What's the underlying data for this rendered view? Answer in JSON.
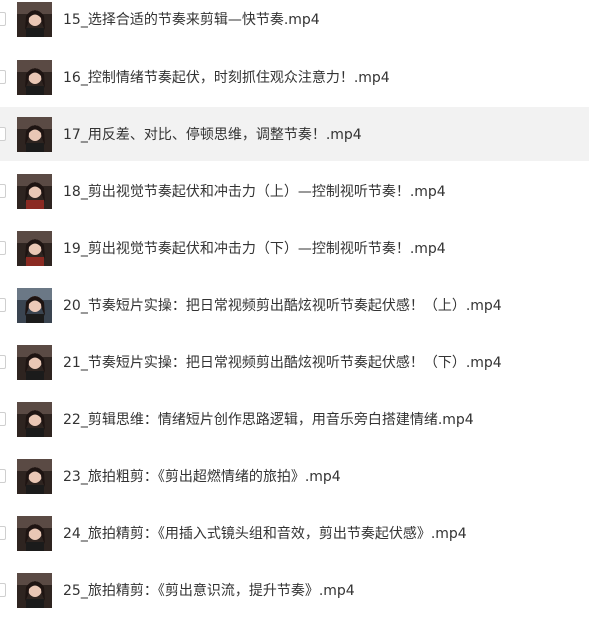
{
  "files": [
    {
      "name": "15_选择合适的节奏来剪辑—快节奏.mp4",
      "thumbnail": "video-thumbnail-icon",
      "hovered": false
    },
    {
      "name": "16_控制情绪节奏起伏，时刻抓住观众注意力！.mp4",
      "thumbnail": "video-thumbnail-icon",
      "hovered": false
    },
    {
      "name": "17_用反差、对比、停顿思维，调整节奏！.mp4",
      "thumbnail": "video-thumbnail-icon",
      "hovered": true
    },
    {
      "name": "18_剪出视觉节奏起伏和冲击力（上）—控制视听节奏！.mp4",
      "thumbnail": "video-thumbnail-icon",
      "hovered": false
    },
    {
      "name": "19_剪出视觉节奏起伏和冲击力（下）—控制视听节奏！.mp4",
      "thumbnail": "video-thumbnail-icon",
      "hovered": false
    },
    {
      "name": "20_节奏短片实操：把日常视频剪出酷炫视听节奏起伏感！（上）.mp4",
      "thumbnail": "video-thumbnail-icon",
      "hovered": false
    },
    {
      "name": "21_节奏短片实操：把日常视频剪出酷炫视听节奏起伏感！（下）.mp4",
      "thumbnail": "video-thumbnail-icon",
      "hovered": false
    },
    {
      "name": "22_剪辑思维：情绪短片创作思路逻辑，用音乐旁白搭建情绪.mp4",
      "thumbnail": "video-thumbnail-icon",
      "hovered": false
    },
    {
      "name": "23_旅拍粗剪：《剪出超燃情绪的旅拍》.mp4",
      "thumbnail": "video-thumbnail-icon",
      "hovered": false
    },
    {
      "name": "24_旅拍精剪：《用插入式镜头组和音效，剪出节奏起伏感》.mp4",
      "thumbnail": "video-thumbnail-icon",
      "hovered": false
    },
    {
      "name": "25_旅拍精剪：《剪出意识流，提升节奏》.mp4",
      "thumbnail": "video-thumbnail-icon",
      "hovered": false
    }
  ],
  "colors": {
    "text": "#333333",
    "hover_row": "#f2f2f2",
    "checkbox_border": "#cfcfcf"
  }
}
